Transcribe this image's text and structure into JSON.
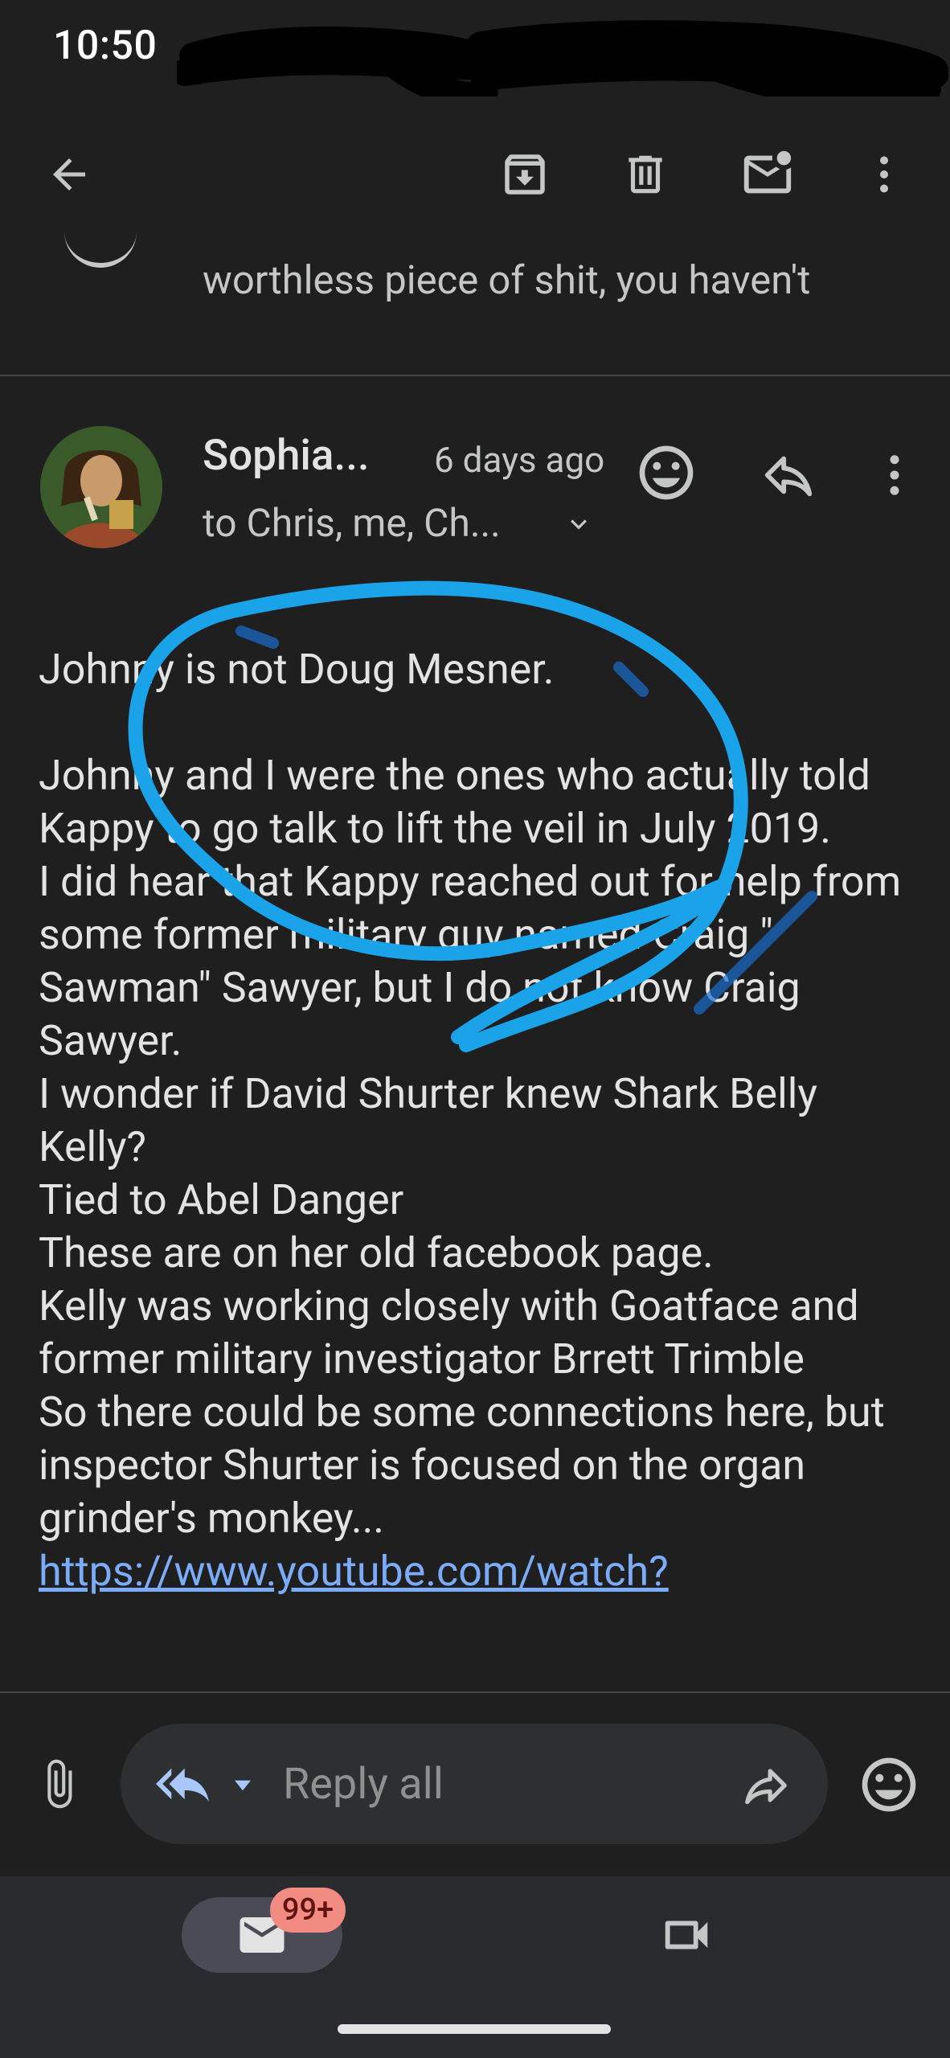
{
  "status_bar": {
    "time": "10:50"
  },
  "toolbar": {
    "back_icon": "arrow-back-icon",
    "archive_icon": "archive-icon",
    "delete_icon": "trash-icon",
    "mark_unread_icon": "mail-unread-icon",
    "more_icon": "more-vert-icon"
  },
  "previous_message": {
    "snippet": "worthless piece of shit, you haven't"
  },
  "message": {
    "sender": "Sophia...",
    "time_ago": "6 days ago",
    "recipients": "to Chris, me, Ch...",
    "body": [
      "Johnny is not Doug Mesner.",
      "",
      "Johnny and I were the ones who actually told Kappy to go talk to lift the veil in July 2019.",
      "I did hear that Kappy reached out for help from some former military guy named Craig \" Sawman\" Sawyer, but I do not know Craig Sawyer.",
      "I wonder if David Shurter knew Shark Belly Kelly?",
      "Tied to Abel Danger",
      "These are on her old facebook page.",
      "Kelly was working closely with Goatface and former military investigator Brrett Trimble",
      "So there could be some connections here, but inspector Shurter is focused on the organ grinder's monkey..."
    ],
    "link": "https://www.youtube.com/watch?"
  },
  "reply_bar": {
    "label": "Reply all"
  },
  "nav": {
    "mail_badge": "99+"
  },
  "colors": {
    "background": "#1f1f1f",
    "annotation": "#1aa3e8",
    "link": "#7cacf8",
    "badge": "#f28b82"
  }
}
